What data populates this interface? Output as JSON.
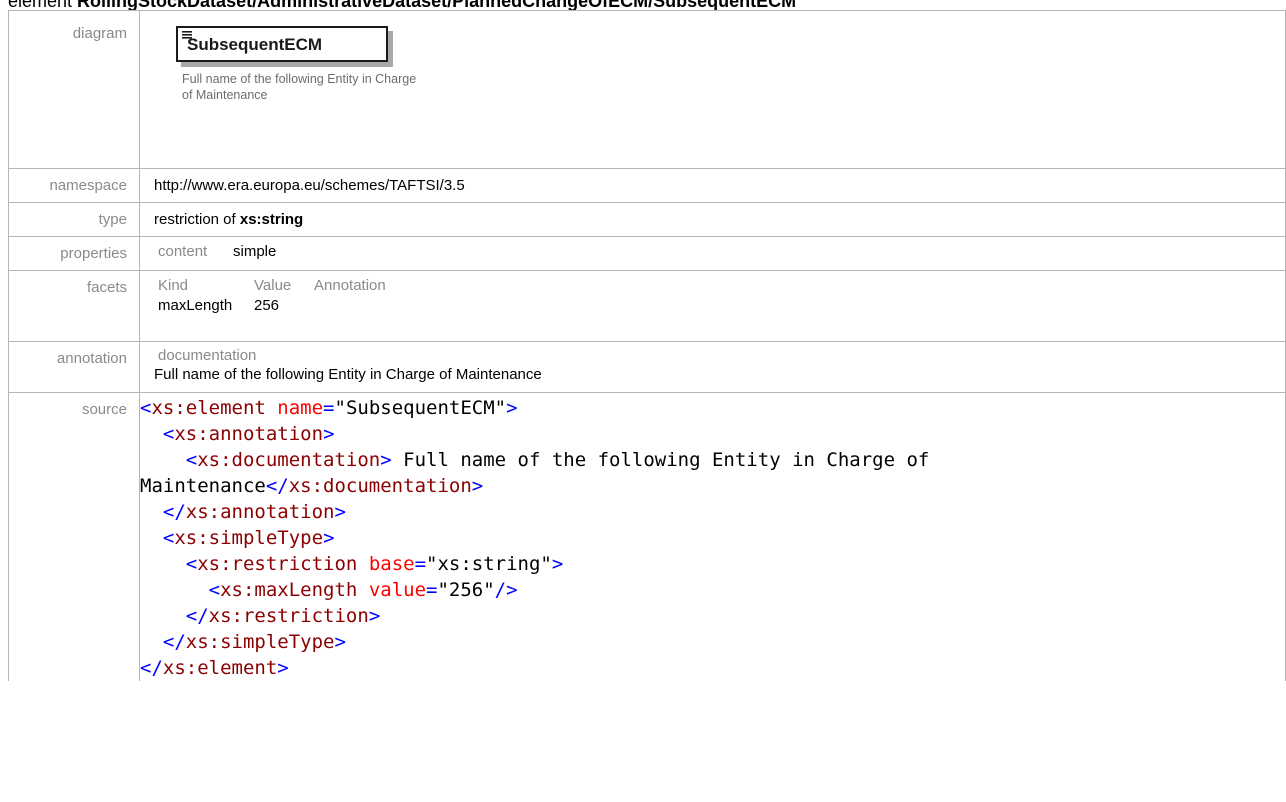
{
  "heading": {
    "prefix": "element ",
    "path": "RollingStockDataset/AdministrativeDataset/PlannedChangeOfECM/SubsequentECM"
  },
  "rows": {
    "diagram": {
      "label": "diagram"
    },
    "namespace": {
      "label": "namespace",
      "value": "http://www.era.europa.eu/schemes/TAFTSI/3.5"
    },
    "type": {
      "label": "type",
      "prefix": "restriction of ",
      "base": "xs:string"
    },
    "properties": {
      "label": "properties",
      "key": "content",
      "value": "simple"
    },
    "facets": {
      "label": "facets",
      "headers": [
        "Kind",
        "Value",
        "Annotation"
      ],
      "rows": [
        {
          "kind": "maxLength",
          "value": "256",
          "annotation": ""
        }
      ]
    },
    "annotation": {
      "label": "annotation",
      "key": "documentation",
      "text": "Full name of the following Entity in Charge of Maintenance"
    },
    "source": {
      "label": "source"
    }
  },
  "diagram": {
    "element_name": "SubsequentECM",
    "doc": "Full name of the following Entity in Charge of Maintenance",
    "icon": "element-lines-icon"
  },
  "source": {
    "l1": {
      "indent": "",
      "open": "<",
      "tag": "xs:element",
      "attr": " name",
      "eq": "=",
      "val": "\"SubsequentECM\"",
      "close": ">"
    },
    "l2": {
      "indent": "  ",
      "open": "<",
      "tag": "xs:annotation",
      "close": ">"
    },
    "l3": {
      "indent": "    ",
      "open": "<",
      "tag": "xs:documentation",
      "close": ">",
      "text": " Full name of the following Entity in Charge of"
    },
    "l4": {
      "text": "Maintenance",
      "open": "</",
      "tag": "xs:documentation",
      "close": ">"
    },
    "l5": {
      "indent": "  ",
      "open": "</",
      "tag": "xs:annotation",
      "close": ">"
    },
    "l6": {
      "indent": "  ",
      "open": "<",
      "tag": "xs:simpleType",
      "close": ">"
    },
    "l7": {
      "indent": "    ",
      "open": "<",
      "tag": "xs:restriction",
      "attr": " base",
      "eq": "=",
      "val": "\"xs:string\"",
      "close": ">"
    },
    "l8": {
      "indent": "      ",
      "open": "<",
      "tag": "xs:maxLength",
      "attr": " value",
      "eq": "=",
      "val": "\"256\"",
      "close": "/>"
    },
    "l9": {
      "indent": "    ",
      "open": "</",
      "tag": "xs:restriction",
      "close": ">"
    },
    "l10": {
      "indent": "  ",
      "open": "</",
      "tag": "xs:simpleType",
      "close": ">"
    },
    "l11": {
      "indent": "",
      "open": "</",
      "tag": "xs:element",
      "close": ">"
    }
  },
  "colors": {
    "tag": "#8b0000",
    "punct": "#0000ff",
    "attr_name": "#ff0000",
    "label": "#8a8a8a",
    "border": "#b5b5b5"
  }
}
